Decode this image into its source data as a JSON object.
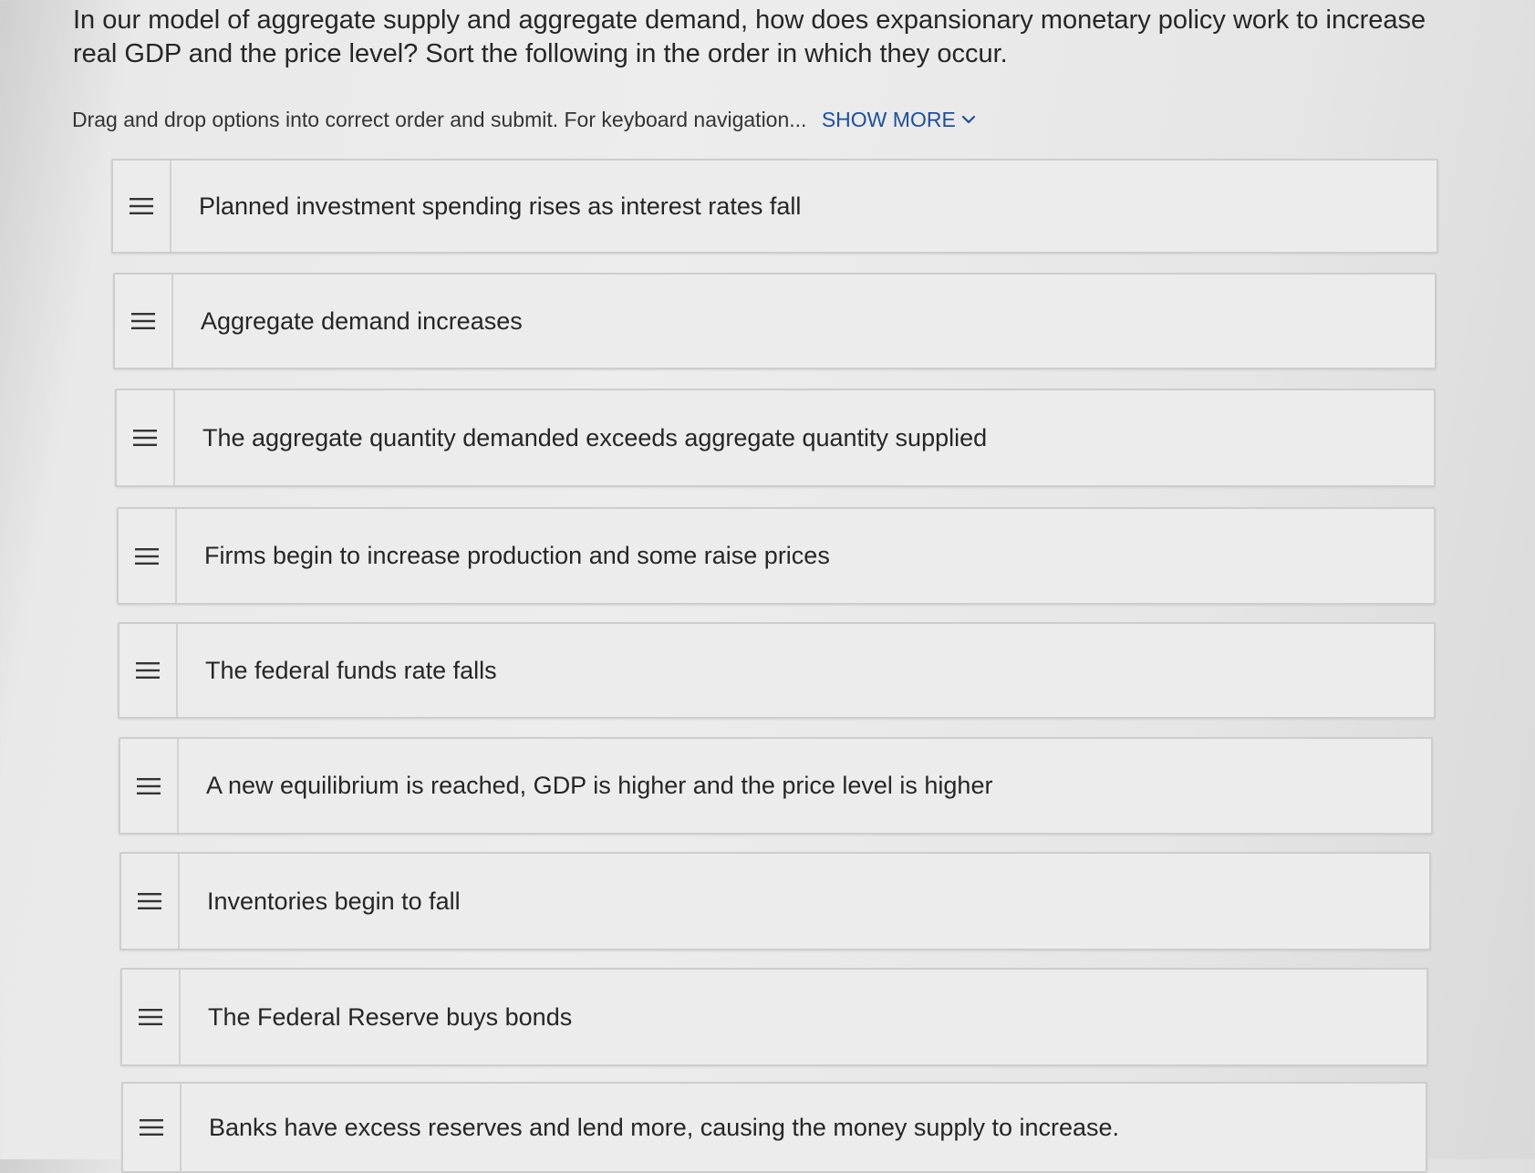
{
  "question": "In our model of aggregate supply and aggregate demand, how does expansionary monetary policy work to increase real GDP and the price level? Sort the following in the order in which they occur.",
  "instructions": {
    "text": "Drag and drop options into correct order and submit. For keyboard navigation...",
    "show_more_label": "SHOW MORE",
    "show_more_icon": "chevron-down-icon"
  },
  "items": [
    {
      "label": "Planned investment spending rises as interest rates fall"
    },
    {
      "label": "Aggregate demand increases"
    },
    {
      "label": "The aggregate quantity demanded exceeds aggregate quantity supplied"
    },
    {
      "label": "Firms begin to increase production and some raise prices"
    },
    {
      "label": "The federal funds rate falls"
    },
    {
      "label": "A new equilibrium is reached, GDP is higher and the price level is higher"
    },
    {
      "label": "Inventories begin to fall"
    },
    {
      "label": "The Federal Reserve buys bonds"
    },
    {
      "label": "Banks have excess reserves and lend more, causing the money supply to increase."
    }
  ],
  "colors": {
    "link": "#1d4f9e",
    "card_background": "#ececec",
    "card_border": "#cdcdcd"
  }
}
